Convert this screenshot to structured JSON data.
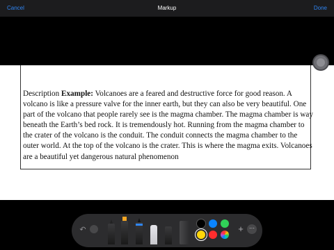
{
  "topbar": {
    "cancel_label": "Cancel",
    "title": "Markup",
    "done_label": "Done"
  },
  "document": {
    "prefix": "Description ",
    "bold_word": "Example:",
    "body": " Volcanoes are a feared and destructive force for good reason.  A volcano is like a pressure valve for the inner earth, but they can also be very beautiful.  One part of the volcano that people rarely see is the magma chamber. The magma chamber is way beneath the Earth’s bed rock.  It is tremendously hot. Running from the magma chamber to the crater of the volcano is the conduit. The conduit connects the magma chamber to the outer world.  At the top of the volcano is the crater. This is where the magma exits. Volcanoes are a beautiful yet dangerous natural phenomenon"
  },
  "toolbar": {
    "tools": [
      "pen-icon",
      "marker-icon",
      "pencil-icon",
      "eraser-icon",
      "lasso-icon",
      "ruler-icon"
    ],
    "colors": [
      "#000000",
      "#0a84ff",
      "#30d158",
      "#ffd60a",
      "#ff2d2d"
    ],
    "selected_color": "#ffd60a",
    "plus_label": "+",
    "more_label": "···"
  }
}
